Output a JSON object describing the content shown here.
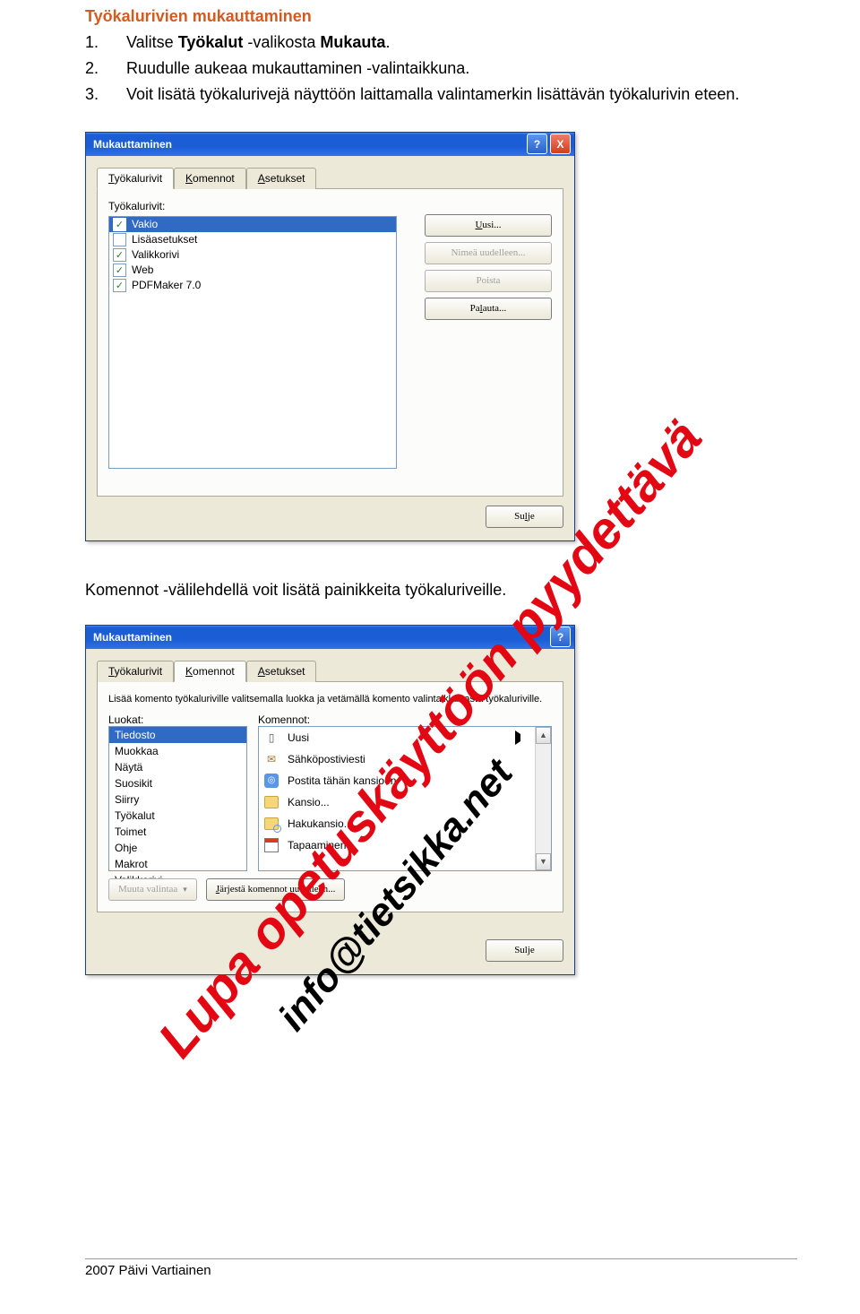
{
  "doc": {
    "title": "Työkalurivien mukauttaminen",
    "steps": [
      {
        "num": "1.",
        "pre": "Valitse ",
        "bold1": "Työkalut",
        "mid": " -valikosta ",
        "bold2": "Mukauta",
        "post": "."
      },
      {
        "num": "2.",
        "text": "Ruudulle aukeaa mukauttaminen -valintaikkuna."
      },
      {
        "num": "3.",
        "text": "Voit lisätä työkalurivejä näyttöön laittamalla valintamerkin lisättävän työkalurivin eteen."
      }
    ],
    "midtext": "Komennot -välilehdellä voit lisätä painikkeita työkaluriveille.",
    "footer": "2007 Päivi Vartiainen"
  },
  "dialog1": {
    "title": "Mukauttaminen",
    "help": "?",
    "close": "X",
    "tabs": [
      {
        "u": "T",
        "rest": "yökalurivit"
      },
      {
        "u": "K",
        "rest": "omennot"
      },
      {
        "u": "A",
        "rest": "setukset"
      }
    ],
    "listLabel": "Työkalurivit:",
    "items": [
      {
        "checked": true,
        "label": "Vakio",
        "selected": true
      },
      {
        "checked": false,
        "label": "Lisäasetukset"
      },
      {
        "checked": true,
        "label": "Valikkorivi"
      },
      {
        "checked": true,
        "label": "Web"
      },
      {
        "checked": true,
        "label": "PDFMaker 7.0"
      }
    ],
    "btns": {
      "new": "Uusi...",
      "rename": "Nimeä uudelleen...",
      "delete": "Poista",
      "reset": "Palauta...",
      "close": "Sulje"
    }
  },
  "dialog2": {
    "title": "Mukauttaminen",
    "help": "?",
    "tabs": [
      {
        "u": "T",
        "rest": "yökalurivit"
      },
      {
        "u": "K",
        "rest": "omennot"
      },
      {
        "u": "A",
        "rest": "setukset"
      }
    ],
    "desc": "Lisää komento työkaluriville valitsemalla luokka ja vetämällä komento valintaikkunasta työkaluriville.",
    "catLabel": "Luokat:",
    "cmdLabel": "Komennot:",
    "categories": [
      {
        "label": "Tiedosto",
        "selected": true
      },
      {
        "label": "Muokkaa"
      },
      {
        "label": "Näytä"
      },
      {
        "label": "Suosikit"
      },
      {
        "label": "Siirry"
      },
      {
        "label": "Työkalut"
      },
      {
        "label": "Toimet"
      },
      {
        "label": "Ohje"
      },
      {
        "label": "Makrot"
      },
      {
        "label": "Valikkorivi"
      }
    ],
    "commands": [
      {
        "icon": "new",
        "label": "Uusi",
        "submenu": true
      },
      {
        "icon": "mail",
        "label": "Sähköpostiviesti"
      },
      {
        "icon": "post",
        "label": "Postita tähän kansioon"
      },
      {
        "icon": "folder",
        "label": "Kansio..."
      },
      {
        "icon": "search",
        "label": "Hakukansio..."
      },
      {
        "icon": "cal",
        "label": "Tapaaminen"
      }
    ],
    "btns": {
      "modify": "Muuta valintaa",
      "reorder": "Järjestä komennot uudelleen...",
      "close": "Sulje"
    }
  },
  "watermark": {
    "wm1": "Lupa opetuskäyttöön pyydettävä",
    "wm2": "info@tietsikka.net"
  }
}
